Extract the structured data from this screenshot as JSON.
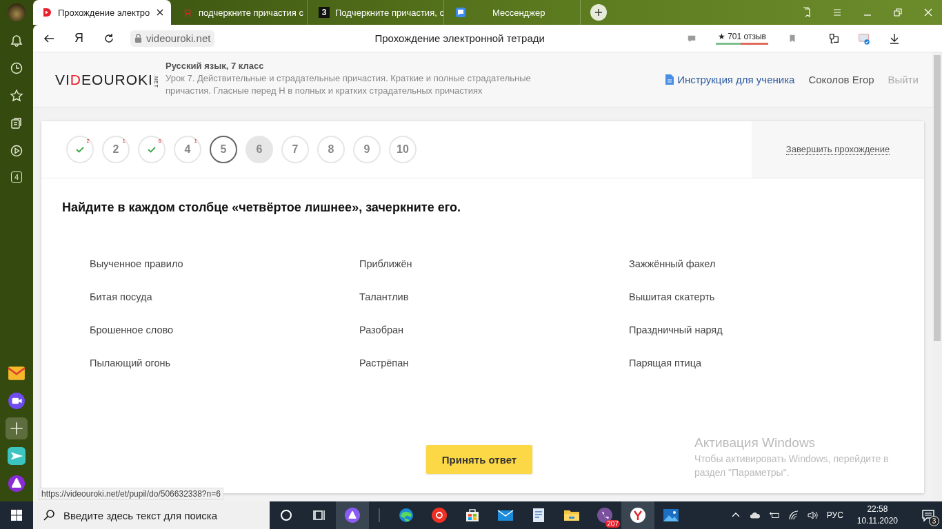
{
  "browser": {
    "tabs": [
      {
        "title": "Прохождение электро",
        "selected": true
      },
      {
        "title": "подчеркните причастия с",
        "icon_text": "Я",
        "selected": false
      },
      {
        "title": "Подчеркните причастия, с",
        "icon_text": "3",
        "selected": false
      },
      {
        "title": "Мессенджер",
        "selected": false
      }
    ],
    "nav_text": "Я",
    "url": "videouroki.net",
    "page_title": "Прохождение электронной тетради",
    "rating": "★ 701 отзыв",
    "status_url": "https://videouroki.net/et/pupil/do/506632338?n=6"
  },
  "sidebar": {
    "counter": "4"
  },
  "site": {
    "logo": {
      "text": "VIDEOUROKI",
      "suffix": ".NET"
    },
    "course": "Русский язык, 7 класс",
    "lesson": "Урок 7. Действительные и страдательные причастия. Краткие и полные страдательные причастия. Гласные перед Н в полных и кратких страдательных причастиях",
    "instruction": "Инструкция для ученика",
    "user": "Соколов Егор",
    "logout": "Выйти"
  },
  "test": {
    "steps": [
      {
        "kind": "done",
        "badge": "2",
        "selected": false,
        "highlighted": false
      },
      {
        "kind": "number",
        "label": "2",
        "badge": "1",
        "selected": false,
        "highlighted": false
      },
      {
        "kind": "done",
        "badge": "6",
        "selected": false,
        "highlighted": false
      },
      {
        "kind": "number",
        "label": "4",
        "badge": "1",
        "selected": false,
        "highlighted": false
      },
      {
        "kind": "number",
        "label": "5",
        "selected": true,
        "highlighted": false
      },
      {
        "kind": "number",
        "label": "6",
        "selected": false,
        "highlighted": true
      },
      {
        "kind": "number",
        "label": "7",
        "selected": false,
        "highlighted": false
      },
      {
        "kind": "number",
        "label": "8",
        "selected": false,
        "highlighted": false
      },
      {
        "kind": "number",
        "label": "9",
        "selected": false,
        "highlighted": false
      },
      {
        "kind": "number",
        "label": "10",
        "selected": false,
        "highlighted": false
      }
    ],
    "finish": "Завершить прохождение",
    "question": "Найдите в каждом столбце «четвёртое лишнее», зачеркните его.",
    "columns": [
      [
        "Выученное правило",
        "Битая посуда",
        "Брошенное слово",
        "Пылающий огонь"
      ],
      [
        "Приближён",
        "Талантлив",
        "Разобран",
        "Растрёпан"
      ],
      [
        "Зажжённый факел",
        "Вышитая скатерть",
        "Праздничный наряд",
        "Парящая птица"
      ]
    ],
    "submit": "Принять ответ"
  },
  "windows_notice": {
    "title": "Активация Windows",
    "text": "Чтобы активировать Windows, перейдите в раздел \"Параметры\"."
  },
  "taskbar": {
    "search_placeholder": "Введите здесь текст для поиска",
    "viber_badge": "207",
    "language": "РУС",
    "time": "22:58",
    "date": "10.11.2020",
    "notifications": "3"
  }
}
